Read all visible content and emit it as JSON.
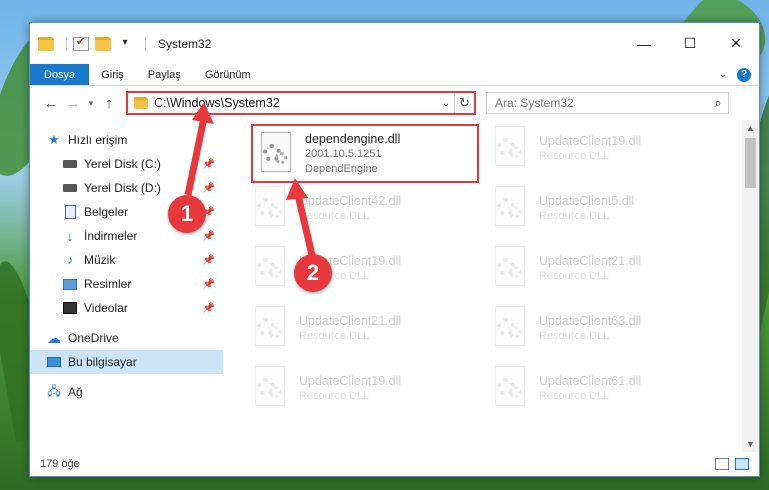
{
  "window": {
    "title": "System32",
    "controls": {
      "minimize": "—",
      "maximize": "☐",
      "close": "✕"
    }
  },
  "ribbon": {
    "tabs": [
      "Dosya",
      "Giriş",
      "Paylaş",
      "Görünüm"
    ]
  },
  "nav": {
    "address": "C:\\Windows\\System32",
    "search_placeholder": "Ara: System32"
  },
  "sidebar": {
    "quick_access": "Hızlı erişim",
    "items": [
      {
        "label": "Yerel Disk (C:)",
        "icon": "disk-icon"
      },
      {
        "label": "Yerel Disk (D:)",
        "icon": "disk-icon"
      },
      {
        "label": "Belgeler",
        "icon": "documents-icon"
      },
      {
        "label": "İndirmeler",
        "icon": "downloads-icon"
      },
      {
        "label": "Müzik",
        "icon": "music-icon"
      },
      {
        "label": "Resimler",
        "icon": "pictures-icon"
      },
      {
        "label": "Videolar",
        "icon": "videos-icon"
      }
    ],
    "onedrive": "OneDrive",
    "this_pc": "Bu bilgisayar",
    "network": "Ağ"
  },
  "files": {
    "highlighted": {
      "name": "dependengine.dll",
      "version": "2001.10.5.1251",
      "description": "DependEngine"
    },
    "items": [
      {
        "name": "UpdateClient19.dll",
        "type": "Resource DLL"
      },
      {
        "name": "UpdateClient42.dll",
        "type": "Resource DLL"
      },
      {
        "name": "UpdateClient5.dll",
        "type": "Resource DLL"
      },
      {
        "name": "UpdateClient19.dll",
        "type": "Resource DLL"
      },
      {
        "name": "UpdateClient21.dll",
        "type": "Resource DLL"
      },
      {
        "name": "UpdateClient21.dll",
        "type": "Resource DLL"
      },
      {
        "name": "UpdateClient63.dll",
        "type": "Resource DLL"
      },
      {
        "name": "UpdateClient19.dll",
        "type": "Resource DLL"
      },
      {
        "name": "UpdateClient61.dll",
        "type": "Resource DLL"
      }
    ]
  },
  "status": {
    "count": "179 öğe"
  },
  "callouts": [
    "1",
    "2"
  ]
}
